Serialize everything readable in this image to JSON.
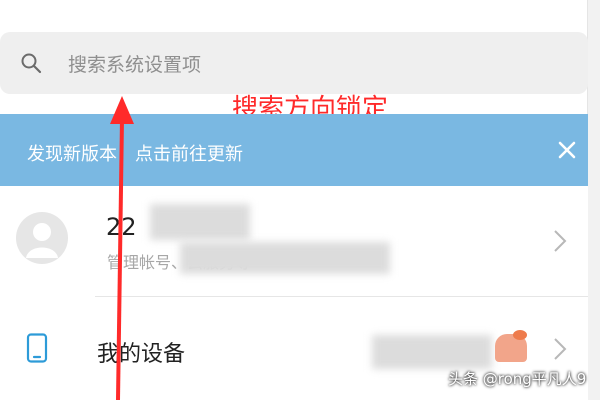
{
  "search": {
    "placeholder": "搜索系统设置项"
  },
  "annotation": {
    "text": "搜索方向锁定"
  },
  "banner": {
    "text": "发现新版本，点击前往更新"
  },
  "account": {
    "name": "22",
    "subtitle": "管理帐号、云服务等"
  },
  "device": {
    "label": "我的设备"
  },
  "watermark": {
    "text": "头条 @rong平凡人9"
  },
  "colors": {
    "banner": "#7ab8e2",
    "device_icon": "#2d9bd8",
    "annotation": "#ff2a2a"
  },
  "icons": {
    "search": "search-icon",
    "close": "close-icon",
    "avatar": "user-avatar-icon",
    "chevron": "chevron-right-icon",
    "device": "phone-icon"
  }
}
